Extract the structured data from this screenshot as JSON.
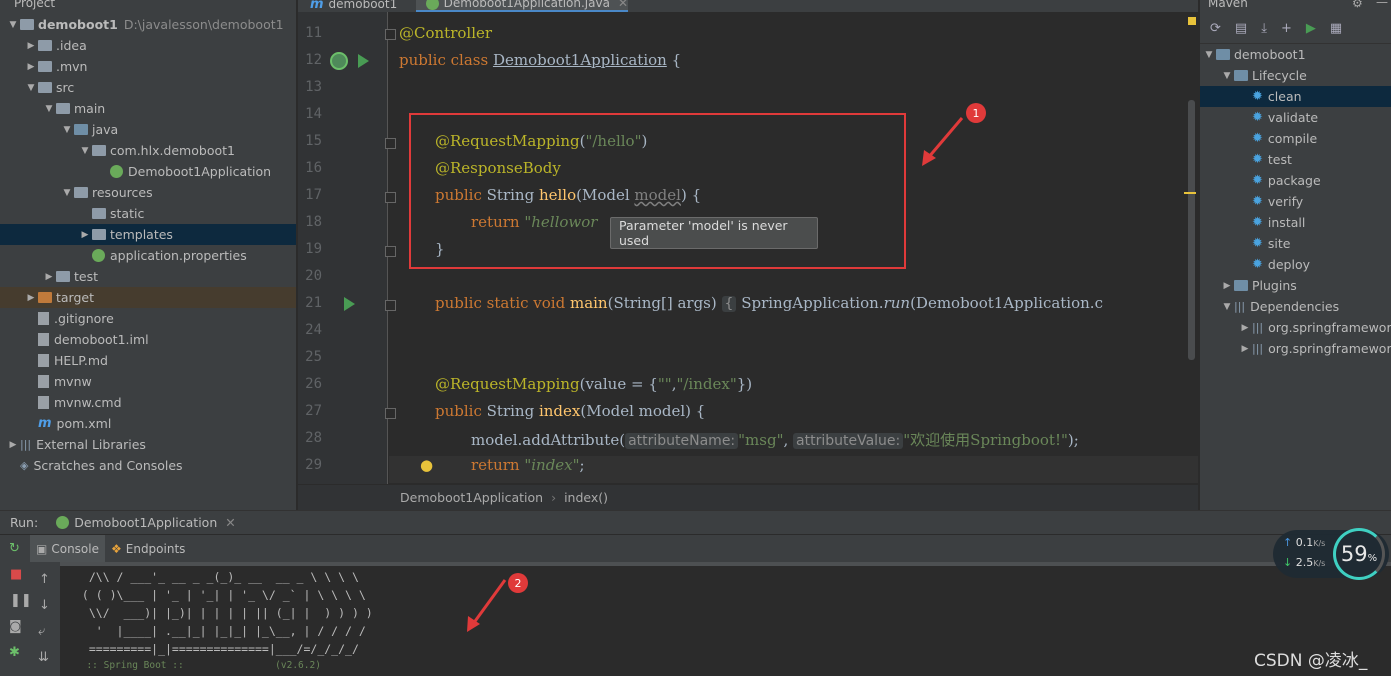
{
  "project": {
    "header": "Project",
    "rows": [
      {
        "label": "demoboot1",
        "extra": "D:\\javalesson\\demoboot1",
        "arrow": "▼",
        "icon": "folder"
      },
      {
        "label": ".idea",
        "arrow": "▶",
        "icon": "folder"
      },
      {
        "label": ".mvn",
        "arrow": "▶",
        "icon": "folder"
      },
      {
        "label": "src",
        "arrow": "▼",
        "icon": "folder"
      },
      {
        "label": "main",
        "arrow": "▼",
        "icon": "folder"
      },
      {
        "label": "java",
        "arrow": "▼",
        "icon": "folder-src"
      },
      {
        "label": "com.hlx.demoboot1",
        "arrow": "▼",
        "icon": "folder"
      },
      {
        "label": "Demoboot1Application",
        "arrow": "",
        "icon": "spring"
      },
      {
        "label": "resources",
        "arrow": "▼",
        "icon": "folder"
      },
      {
        "label": "static",
        "arrow": "",
        "icon": "folder"
      },
      {
        "label": "templates",
        "arrow": "▶",
        "icon": "folder"
      },
      {
        "label": "application.properties",
        "arrow": "",
        "icon": "spring"
      },
      {
        "label": "test",
        "arrow": "▶",
        "icon": "folder"
      },
      {
        "label": "target",
        "arrow": "▶",
        "icon": "folder-orange"
      },
      {
        "label": ".gitignore",
        "arrow": "",
        "icon": "file"
      },
      {
        "label": "demoboot1.iml",
        "arrow": "",
        "icon": "file"
      },
      {
        "label": "HELP.md",
        "arrow": "",
        "icon": "file"
      },
      {
        "label": "mvnw",
        "arrow": "",
        "icon": "file"
      },
      {
        "label": "mvnw.cmd",
        "arrow": "",
        "icon": "file"
      },
      {
        "label": "pom.xml",
        "arrow": "",
        "icon": "maven"
      },
      {
        "label": "External Libraries",
        "arrow": "▶",
        "icon": "lib"
      },
      {
        "label": "Scratches and Consoles",
        "arrow": "",
        "icon": "scratch"
      }
    ]
  },
  "tabs": {
    "first": "demoboot1",
    "active": "Demoboot1Application.java"
  },
  "editor": {
    "line_numbers": [
      "11",
      "12",
      "13",
      "14",
      "15",
      "16",
      "17",
      "18",
      "19",
      "20",
      "21",
      "24",
      "25",
      "26",
      "27",
      "28",
      "29"
    ],
    "line1": "@Controller",
    "line2_kw": "public class ",
    "line2_name": "Demoboot1Application",
    "line2_rest": " {",
    "rm1_ann": "@RequestMapping",
    "rm1_open": "(",
    "rm1_str": "\"/hello\"",
    "rm1_close": ")",
    "rb_ann": "@ResponseBody",
    "hello_kw": "public ",
    "hello_type": "String ",
    "hello_fn": "hello",
    "hello_params": "(Model ",
    "hello_param": "model",
    "hello_end": ") {",
    "return_kw": "return ",
    "return_str": "\"hellowor",
    "close_brace": "}",
    "main_kw": "public static void ",
    "main_fn": "main",
    "main_params": "(String[] args) ",
    "main_fold": "{",
    "main_body": " SpringApplication.",
    "main_run": "run",
    "main_tail": "(Demoboot1Application.c",
    "rm2_ann": "@RequestMapping",
    "rm2_open": "(value = {",
    "rm2_str1": "\"\"",
    "rm2_comma": ",",
    "rm2_str2": "\"/index\"",
    "rm2_close": "})",
    "index_kw": "public ",
    "index_type": "String ",
    "index_fn": "index",
    "index_rest": "(Model model) {",
    "add_call": "model.addAttribute(",
    "hint1": "attributeName:",
    "add_str1": "\"msg\"",
    "add_comma": ", ",
    "hint2": "attributeValue:",
    "add_str2": "\"欢迎使用Springboot!\"",
    "add_end": ");",
    "ret2_kw": "return ",
    "ret2_str": "\"index\"",
    "ret2_end": ";",
    "tooltip": "Parameter 'model' is never used"
  },
  "breadcrumb": {
    "cls": "Demoboot1Application",
    "method": "index()"
  },
  "maven": {
    "header": "Maven",
    "rows": [
      {
        "label": "demoboot1",
        "arrow": "▼",
        "icon": "maven"
      },
      {
        "label": "Lifecycle",
        "arrow": "▼",
        "icon": "folder"
      },
      {
        "label": "clean",
        "icon": "gear",
        "selected": true
      },
      {
        "label": "validate",
        "icon": "gear"
      },
      {
        "label": "compile",
        "icon": "gear"
      },
      {
        "label": "test",
        "icon": "gear"
      },
      {
        "label": "package",
        "icon": "gear"
      },
      {
        "label": "verify",
        "icon": "gear"
      },
      {
        "label": "install",
        "icon": "gear"
      },
      {
        "label": "site",
        "icon": "gear"
      },
      {
        "label": "deploy",
        "icon": "gear"
      },
      {
        "label": "Plugins",
        "arrow": "▶",
        "icon": "folder"
      },
      {
        "label": "Dependencies",
        "arrow": "▼",
        "icon": "lib"
      },
      {
        "label": "org.springframewor",
        "arrow": "▶",
        "icon": "lib"
      },
      {
        "label": "org.springframewor",
        "arrow": "▶",
        "icon": "lib"
      }
    ]
  },
  "run": {
    "label": "Run:",
    "config": "Demoboot1Application",
    "console_tab": "Console",
    "endpoints_tab": "Endpoints",
    "banner": [
      "  /\\\\ / ___'_ __ _ _(_)_ __  __ _ \\ \\ \\ \\",
      " ( ( )\\___ | '_ | '_| | '_ \\/ _` | \\ \\ \\ \\",
      "  \\\\/  ___)| |_)| | | | | || (_| |  ) ) ) )",
      "   '  |____| .__|_| |_|_| |_\\__, | / / / /",
      "  =========|_|==============|___/=/_/_/_/",
      "  :: Spring Boot ::                (v2.6.2)"
    ]
  },
  "network": {
    "up": "0.1",
    "up_unit": "K/s",
    "down": "2.5",
    "down_unit": "K/s",
    "percent": "59",
    "percent_sign": "%"
  },
  "annotations": {
    "badge1": "1",
    "badge2": "2",
    "watermark": "CSDN @凌冰_"
  },
  "colors": {
    "highlight_box": "#e03a3a",
    "selection": "#0d293e"
  }
}
